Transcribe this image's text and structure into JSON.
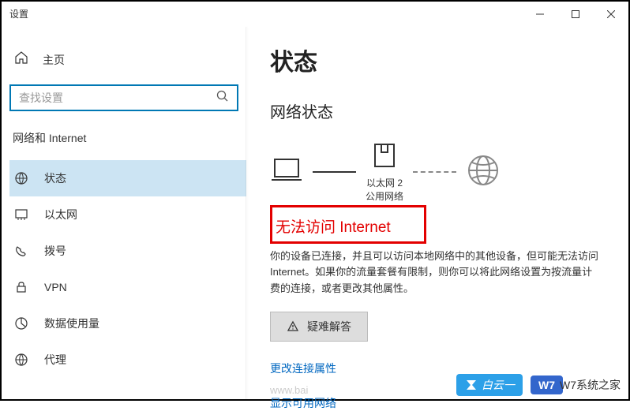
{
  "window": {
    "title": "设置"
  },
  "sidebar": {
    "home_label": "主页",
    "search_placeholder": "查找设置",
    "section_header": "网络和 Internet",
    "items": [
      {
        "label": "状态",
        "icon": "status",
        "active": true
      },
      {
        "label": "以太网",
        "icon": "ethernet",
        "active": false
      },
      {
        "label": "拨号",
        "icon": "dialup",
        "active": false
      },
      {
        "label": "VPN",
        "icon": "vpn",
        "active": false
      },
      {
        "label": "数据使用量",
        "icon": "usage",
        "active": false
      },
      {
        "label": "代理",
        "icon": "proxy",
        "active": false
      }
    ]
  },
  "main": {
    "page_title": "状态",
    "sub_title": "网络状态",
    "router_name": "以太网 2",
    "router_type": "公用网络",
    "error_text": "无法访问 Internet",
    "description": "你的设备已连接，并且可以访问本地网络中的其他设备，但可能无法访问 Internet。如果你的流量套餐有限制，则你可以将此网络设置为按流量计费的连接，或者更改其他属性。",
    "trouble_btn": "疑难解答",
    "link_change": "更改连接属性",
    "link_show": "显示可用网络"
  },
  "watermark": {
    "byun": "白云一",
    "w7_logo": "W7",
    "w7_text": "W7系统之家",
    "baidu": "www.bai"
  }
}
